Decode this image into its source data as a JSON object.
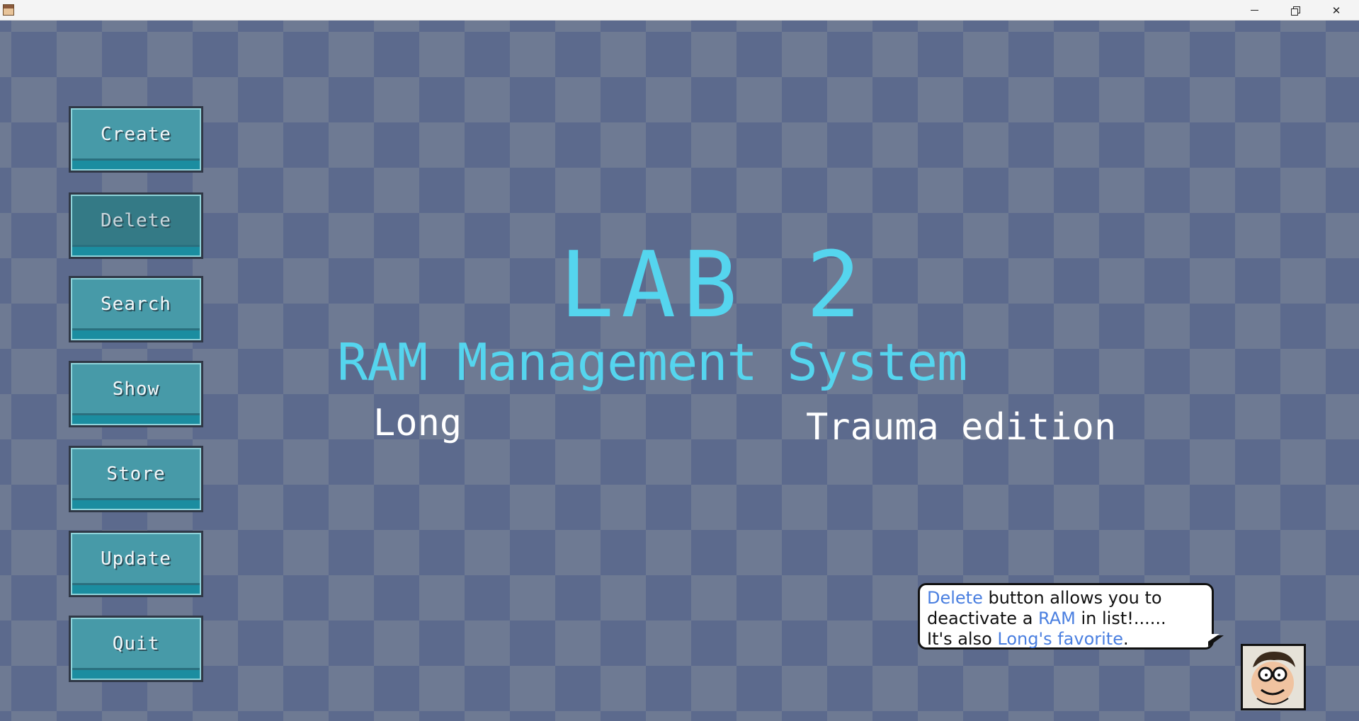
{
  "window": {
    "title": "",
    "controls": {
      "minimize_icon": "minimize-icon",
      "maximize_icon": "restore-icon",
      "close_label": "✕"
    }
  },
  "menu": {
    "buttons": [
      {
        "label": "Create",
        "active": false
      },
      {
        "label": "Delete",
        "active": true
      },
      {
        "label": "Search",
        "active": false
      },
      {
        "label": "Show",
        "active": false
      },
      {
        "label": "Store",
        "active": false
      },
      {
        "label": "Update",
        "active": false
      },
      {
        "label": "Quit",
        "active": false
      }
    ]
  },
  "header": {
    "title": "LAB 2",
    "subtitle": "RAM Management System",
    "author": "Long",
    "edition": "Trauma edition"
  },
  "tooltip": {
    "line1_highlight": "Delete",
    "line1_rest": " button allows you to",
    "line2_start": "deactivate a ",
    "line2_highlight": "RAM",
    "line2_rest": " in list!......",
    "line3_start": "It's also ",
    "line3_highlight": "Long's favorite",
    "line3_end": "."
  },
  "colors": {
    "title": "#55d5ee",
    "button_face": "#479aa8",
    "button_active_face": "#347a86",
    "highlight_text": "#4a7fe0",
    "checker_dark": "#5c6a8d",
    "checker_light": "#6e7a93"
  },
  "avatar": {
    "icon": "peter-griffin-face-icon"
  }
}
